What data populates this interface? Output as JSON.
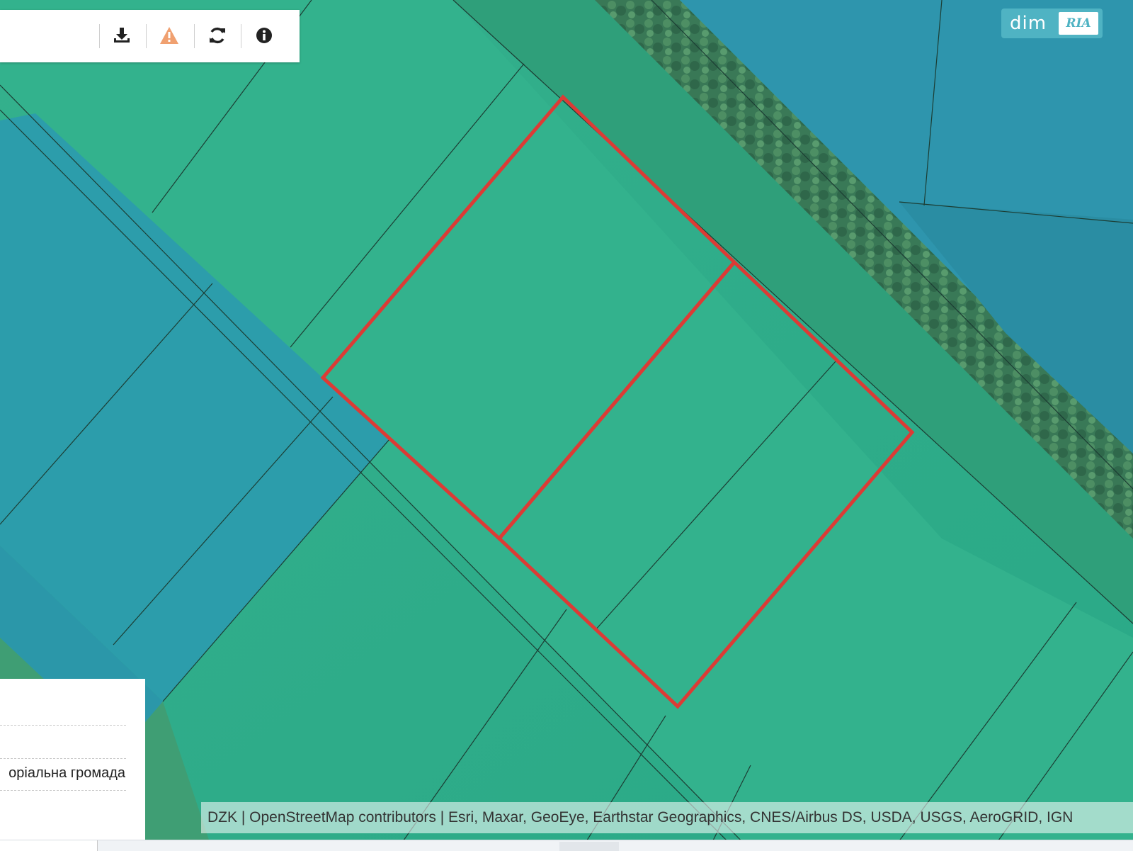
{
  "map": {
    "basemap_colors": {
      "land_green": "#30b08b",
      "land_teal": "#2a9da3",
      "blue_parcels": "#2f94ad",
      "tree_strip": "#3e7a57",
      "parcel_line": "#1c3d33",
      "highlight": "#dc3b35"
    },
    "highlighted_parcels": 2
  },
  "toolbar": {
    "buttons": [
      {
        "icon": "download-icon",
        "color": "#222222"
      },
      {
        "icon": "warning-icon",
        "color": "#f0a070"
      },
      {
        "icon": "refresh-icon",
        "color": "#222222"
      },
      {
        "icon": "info-icon",
        "color": "#222222"
      }
    ]
  },
  "logo": {
    "dim": "dim",
    "ria": "RIA"
  },
  "info_panel": {
    "text": "оріальна громада"
  },
  "attribution": {
    "text": "DZK | OpenStreetMap contributors | Esri, Maxar, GeoEye, Earthstar Geographics, CNES/Airbus DS, USDA, USGS, AeroGRID, IGN"
  }
}
